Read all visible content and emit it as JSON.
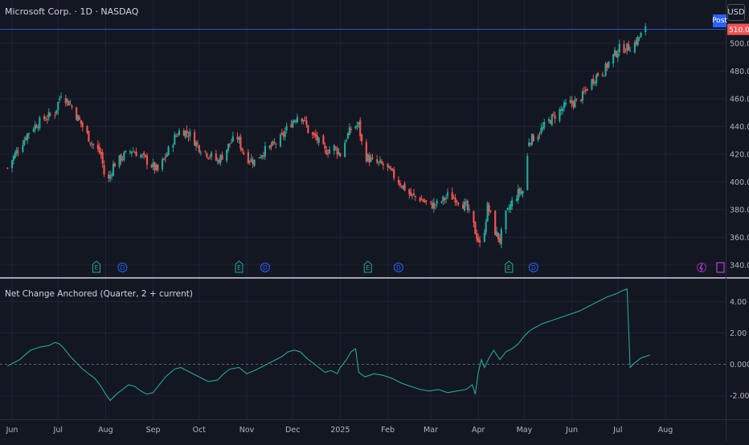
{
  "header": {
    "symbol_title": "Microsoft Corp. · 1D · NASDAQ",
    "currency_button": "USD",
    "post_badge": "Post"
  },
  "indicator": {
    "title": "Net Change Anchored (Quarter, 2 + current)"
  },
  "colors": {
    "background": "#131722",
    "up": "#26a69a",
    "down": "#ef5350",
    "grid": "#1f2431",
    "indicator_line": "#26a69a",
    "price_line": "#2962ff",
    "last_price_label": "#ef5350",
    "events_earnings": "#26a69a",
    "events_dividend": "#2962ff"
  },
  "chart_data": [
    {
      "type": "candlestick",
      "yaxis_ticks": [
        "500.00",
        "480.00",
        "460.00",
        "440.00",
        "420.00",
        "400.00",
        "380.00",
        "360.00",
        "340.00"
      ],
      "ylim": [
        333,
        515
      ],
      "last_price": 510.05,
      "last_price_label": "510.05",
      "x_ticks": [
        {
          "label": "Jun",
          "day": 0
        },
        {
          "label": "Jul",
          "day": 30
        },
        {
          "label": "Aug",
          "day": 61
        },
        {
          "label": "Sep",
          "day": 92
        },
        {
          "label": "Oct",
          "day": 122
        },
        {
          "label": "Nov",
          "day": 153
        },
        {
          "label": "Dec",
          "day": 183
        },
        {
          "label": "2025",
          "day": 214
        },
        {
          "label": "Feb",
          "day": 245
        },
        {
          "label": "Mar",
          "day": 273
        },
        {
          "label": "Apr",
          "day": 304
        },
        {
          "label": "May",
          "day": 334
        },
        {
          "label": "Jun",
          "day": 365
        },
        {
          "label": "Jul",
          "day": 395
        },
        {
          "label": "Aug",
          "day": 426
        }
      ],
      "close_anchors": [
        [
          -3,
          410
        ],
        [
          4,
          424
        ],
        [
          12,
          438
        ],
        [
          20,
          445
        ],
        [
          28,
          450
        ],
        [
          32,
          464
        ],
        [
          38,
          456
        ],
        [
          45,
          442
        ],
        [
          52,
          428
        ],
        [
          58,
          420
        ],
        [
          60,
          406
        ],
        [
          62,
          398
        ],
        [
          66,
          412
        ],
        [
          72,
          418
        ],
        [
          78,
          423
        ],
        [
          84,
          419
        ],
        [
          90,
          413
        ],
        [
          95,
          408
        ],
        [
          100,
          418
        ],
        [
          106,
          432
        ],
        [
          110,
          438
        ],
        [
          116,
          434
        ],
        [
          122,
          425
        ],
        [
          128,
          420
        ],
        [
          134,
          415
        ],
        [
          138,
          420
        ],
        [
          142,
          428
        ],
        [
          147,
          432
        ],
        [
          152,
          418
        ],
        [
          158,
          415
        ],
        [
          164,
          422
        ],
        [
          170,
          426
        ],
        [
          176,
          432
        ],
        [
          180,
          440
        ],
        [
          186,
          448
        ],
        [
          190,
          446
        ],
        [
          194,
          434
        ],
        [
          198,
          432
        ],
        [
          204,
          422
        ],
        [
          210,
          425
        ],
        [
          214,
          420
        ],
        [
          218,
          432
        ],
        [
          222,
          440
        ],
        [
          226,
          441
        ],
        [
          228,
          428
        ],
        [
          231,
          418
        ],
        [
          236,
          414
        ],
        [
          242,
          412
        ],
        [
          246,
          408
        ],
        [
          254,
          398
        ],
        [
          260,
          390
        ],
        [
          266,
          388
        ],
        [
          272,
          383
        ],
        [
          278,
          384
        ],
        [
          284,
          390
        ],
        [
          290,
          388
        ],
        [
          296,
          382
        ],
        [
          300,
          372
        ],
        [
          302,
          364
        ],
        [
          304,
          358
        ],
        [
          306,
          350
        ],
        [
          308,
          366
        ],
        [
          310,
          382
        ],
        [
          312,
          376
        ],
        [
          315,
          364
        ],
        [
          318,
          358
        ],
        [
          322,
          376
        ],
        [
          326,
          385
        ],
        [
          330,
          392
        ],
        [
          334,
          394
        ],
        [
          337,
          430
        ],
        [
          340,
          432
        ],
        [
          344,
          436
        ],
        [
          350,
          444
        ],
        [
          356,
          450
        ],
        [
          362,
          456
        ],
        [
          368,
          458
        ],
        [
          372,
          462
        ],
        [
          376,
          470
        ],
        [
          382,
          478
        ],
        [
          386,
          480
        ],
        [
          390,
          488
        ],
        [
          396,
          496
        ],
        [
          402,
          497
        ],
        [
          406,
          500
        ],
        [
          410,
          506
        ],
        [
          413,
          510
        ]
      ],
      "gap_days": [
        335,
        336
      ]
    },
    {
      "type": "line",
      "name": "Net Change Anchored",
      "yaxis_ticks": [
        "4.00",
        "2.00",
        "0.000",
        "-2.00"
      ],
      "ylim": [
        -3.5,
        5.2
      ],
      "zero_line": true,
      "points": [
        [
          -3,
          -0.1
        ],
        [
          5,
          0.3
        ],
        [
          12,
          0.9
        ],
        [
          18,
          1.1
        ],
        [
          24,
          1.2
        ],
        [
          28,
          1.4
        ],
        [
          31,
          1.3
        ],
        [
          34,
          1.0
        ],
        [
          38,
          0.5
        ],
        [
          42,
          0.1
        ],
        [
          46,
          -0.3
        ],
        [
          50,
          -0.6
        ],
        [
          54,
          -0.9
        ],
        [
          58,
          -1.4
        ],
        [
          61,
          -1.9
        ],
        [
          64,
          -2.3
        ],
        [
          68,
          -1.9
        ],
        [
          72,
          -1.6
        ],
        [
          76,
          -1.3
        ],
        [
          80,
          -1.4
        ],
        [
          84,
          -1.7
        ],
        [
          88,
          -1.9
        ],
        [
          92,
          -1.8
        ],
        [
          96,
          -1.3
        ],
        [
          100,
          -0.8
        ],
        [
          106,
          -0.3
        ],
        [
          110,
          -0.2
        ],
        [
          116,
          -0.5
        ],
        [
          122,
          -0.8
        ],
        [
          128,
          -1.1
        ],
        [
          134,
          -1.0
        ],
        [
          138,
          -0.6
        ],
        [
          142,
          -0.3
        ],
        [
          148,
          -0.2
        ],
        [
          153,
          -0.6
        ],
        [
          158,
          -0.4
        ],
        [
          164,
          -0.1
        ],
        [
          170,
          0.2
        ],
        [
          176,
          0.5
        ],
        [
          180,
          0.8
        ],
        [
          184,
          0.9
        ],
        [
          188,
          0.8
        ],
        [
          192,
          0.4
        ],
        [
          196,
          0.1
        ],
        [
          200,
          -0.2
        ],
        [
          204,
          -0.5
        ],
        [
          208,
          -0.4
        ],
        [
          212,
          -0.6
        ],
        [
          214,
          -0.2
        ],
        [
          218,
          0.3
        ],
        [
          221,
          0.8
        ],
        [
          224,
          1.0
        ],
        [
          226,
          -0.5
        ],
        [
          230,
          -0.8
        ],
        [
          236,
          -0.6
        ],
        [
          242,
          -0.7
        ],
        [
          248,
          -0.9
        ],
        [
          254,
          -1.2
        ],
        [
          260,
          -1.4
        ],
        [
          266,
          -1.6
        ],
        [
          272,
          -1.7
        ],
        [
          278,
          -1.6
        ],
        [
          284,
          -1.8
        ],
        [
          290,
          -1.7
        ],
        [
          296,
          -1.6
        ],
        [
          300,
          -1.3
        ],
        [
          302,
          -1.9
        ],
        [
          304,
          -0.5
        ],
        [
          306,
          0.3
        ],
        [
          308,
          -0.2
        ],
        [
          311,
          0.4
        ],
        [
          314,
          0.9
        ],
        [
          318,
          0.3
        ],
        [
          322,
          0.8
        ],
        [
          326,
          1.0
        ],
        [
          330,
          1.3
        ],
        [
          334,
          1.8
        ],
        [
          337,
          2.1
        ],
        [
          340,
          2.3
        ],
        [
          346,
          2.6
        ],
        [
          352,
          2.8
        ],
        [
          358,
          3.0
        ],
        [
          364,
          3.2
        ],
        [
          370,
          3.4
        ],
        [
          376,
          3.7
        ],
        [
          382,
          4.0
        ],
        [
          388,
          4.3
        ],
        [
          394,
          4.5
        ],
        [
          398,
          4.7
        ],
        [
          401,
          4.8
        ],
        [
          403,
          -0.2
        ],
        [
          406,
          0.1
        ],
        [
          410,
          0.4
        ],
        [
          413,
          0.5
        ],
        [
          416,
          0.6
        ]
      ]
    }
  ],
  "events": [
    {
      "type": "E",
      "label": "E",
      "day": 55
    },
    {
      "type": "D",
      "label": "D",
      "day": 72
    },
    {
      "type": "E",
      "label": "E",
      "day": 148
    },
    {
      "type": "D",
      "label": "D",
      "day": 165
    },
    {
      "type": "E",
      "label": "E",
      "day": 232
    },
    {
      "type": "D",
      "label": "D",
      "day": 252
    },
    {
      "type": "E",
      "label": "E",
      "day": 324
    },
    {
      "type": "D",
      "label": "D",
      "day": 340
    }
  ]
}
